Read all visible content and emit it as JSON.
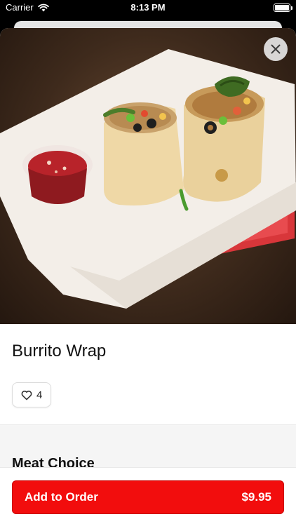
{
  "status_bar": {
    "carrier": "Carrier",
    "time": "8:13 PM",
    "battery_level": 1.0
  },
  "item": {
    "name": "Burrito Wrap",
    "likes_count": "4",
    "image_subject": "burrito-wrap-photo"
  },
  "sections": {
    "meat_choice_title": "Meat Choice"
  },
  "footer": {
    "add_label": "Add to Order",
    "price": "$9.95"
  },
  "colors": {
    "accent": "#f20d0d"
  }
}
